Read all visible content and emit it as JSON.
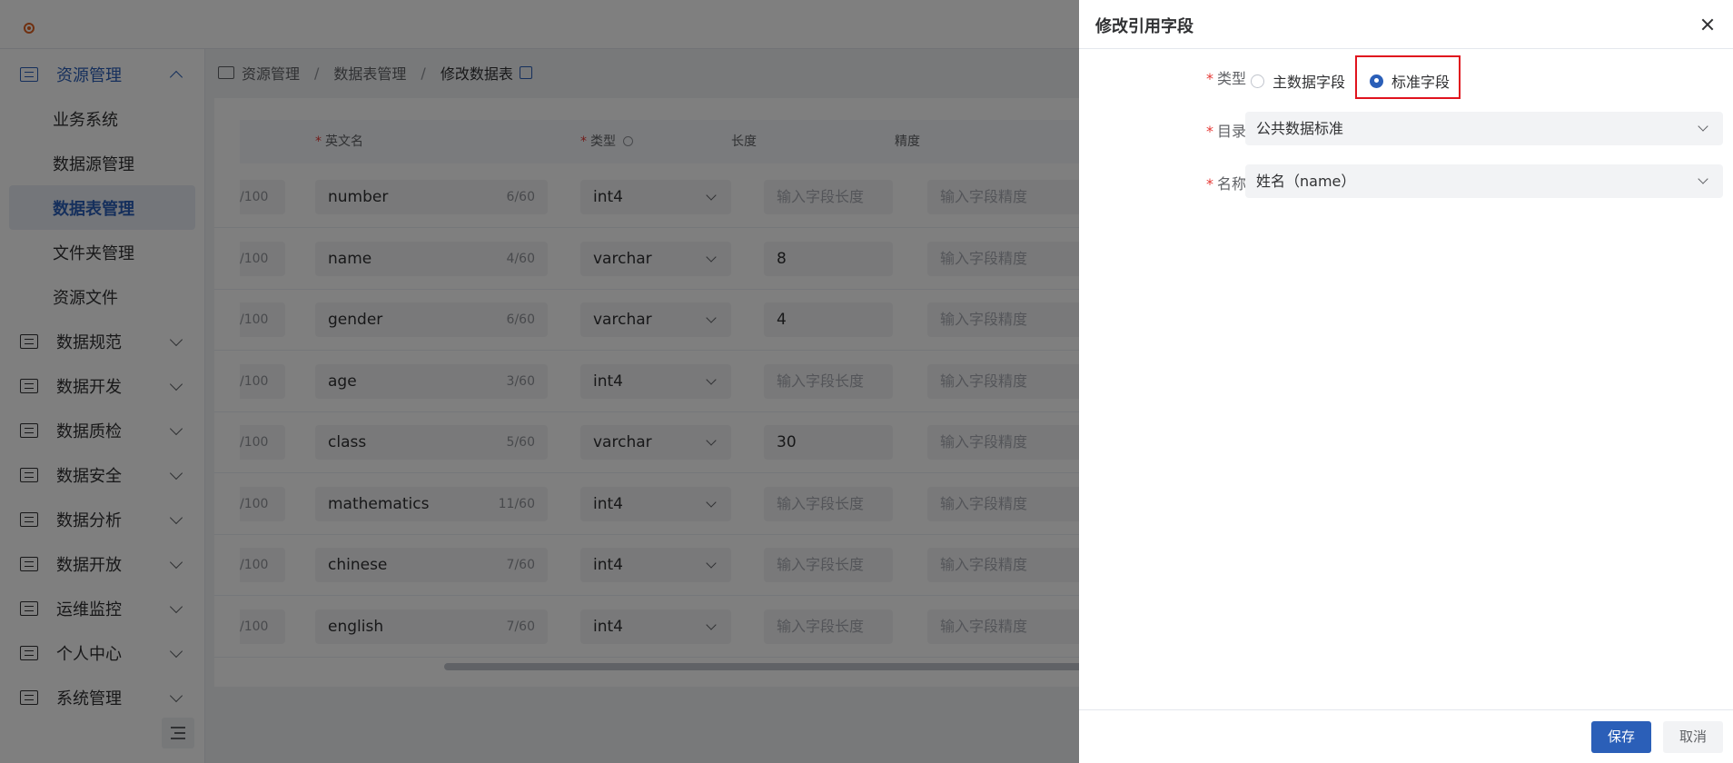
{
  "sidebar": {
    "group_resource": "资源管理",
    "sub_items": [
      "业务系统",
      "数据源管理",
      "数据表管理",
      "文件夹管理",
      "资源文件"
    ],
    "groups": [
      "数据规范",
      "数据开发",
      "数据质检",
      "数据安全",
      "数据分析",
      "数据开放",
      "运维监控",
      "个人中心",
      "系统管理"
    ]
  },
  "breadcrumb": {
    "level1": "资源管理",
    "sep": "/",
    "level2": "数据表管理",
    "level3": "修改数据表"
  },
  "table": {
    "headers": {
      "required_mark": "*",
      "english_name": "英文名",
      "type": "类型",
      "length": "长度",
      "precision": "精度"
    },
    "length_placeholder": "输入字段长度",
    "precision_placeholder": "输入字段精度",
    "rows": [
      {
        "desc_count": "/100",
        "name": "number",
        "name_count": "6/60",
        "type": "int4",
        "length": ""
      },
      {
        "desc_count": "/100",
        "name": "name",
        "name_count": "4/60",
        "type": "varchar",
        "length": "8"
      },
      {
        "desc_count": "/100",
        "name": "gender",
        "name_count": "6/60",
        "type": "varchar",
        "length": "4"
      },
      {
        "desc_count": "/100",
        "name": "age",
        "name_count": "3/60",
        "type": "int4",
        "length": ""
      },
      {
        "desc_count": "/100",
        "name": "class",
        "name_count": "5/60",
        "type": "varchar",
        "length": "30"
      },
      {
        "desc_count": "/100",
        "name": "mathematics",
        "name_count": "11/60",
        "type": "int4",
        "length": ""
      },
      {
        "desc_count": "/100",
        "name": "chinese",
        "name_count": "7/60",
        "type": "int4",
        "length": ""
      },
      {
        "desc_count": "/100",
        "name": "english",
        "name_count": "7/60",
        "type": "int4",
        "length": ""
      }
    ]
  },
  "drawer": {
    "title": "修改引用字段",
    "required_mark": "*",
    "type_label": "类型",
    "radio_master": "主数据字段",
    "radio_standard": "标准字段",
    "catalog_label": "目录",
    "catalog_value": "公共数据标准",
    "name_label": "名称",
    "name_value": "姓名（name）",
    "save_label": "保存",
    "cancel_label": "取消"
  },
  "colors": {
    "primary": "#2b5fb8",
    "required": "#e53935",
    "highlight": "#e0141e"
  }
}
